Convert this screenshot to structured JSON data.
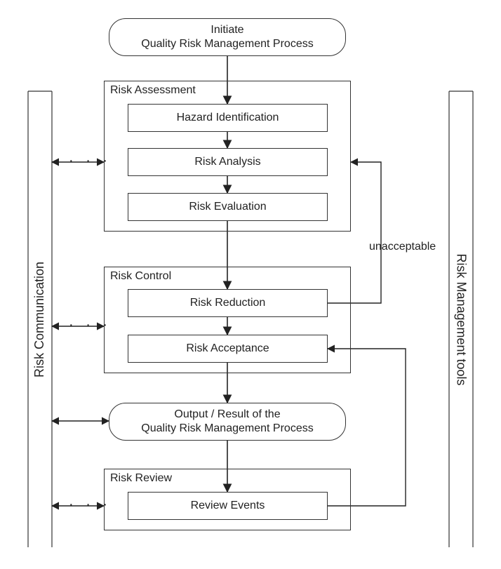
{
  "initiate": {
    "line1": "Initiate",
    "line2": "Quality Risk Management Process"
  },
  "assessment": {
    "title": "Risk Assessment",
    "hazard": "Hazard Identification",
    "analysis": "Risk Analysis",
    "evaluation": "Risk Evaluation"
  },
  "control": {
    "title": "Risk Control",
    "reduction": "Risk Reduction",
    "acceptance": "Risk Acceptance"
  },
  "output": {
    "line1": "Output / Result of the",
    "line2": "Quality Risk Management Process"
  },
  "review": {
    "title": "Risk Review",
    "events": "Review Events"
  },
  "sides": {
    "communication": "Risk Communication",
    "tools": "Risk Management tools"
  },
  "labels": {
    "unacceptable": "unacceptable"
  },
  "glyphs": {
    "dots": "· · ·"
  }
}
